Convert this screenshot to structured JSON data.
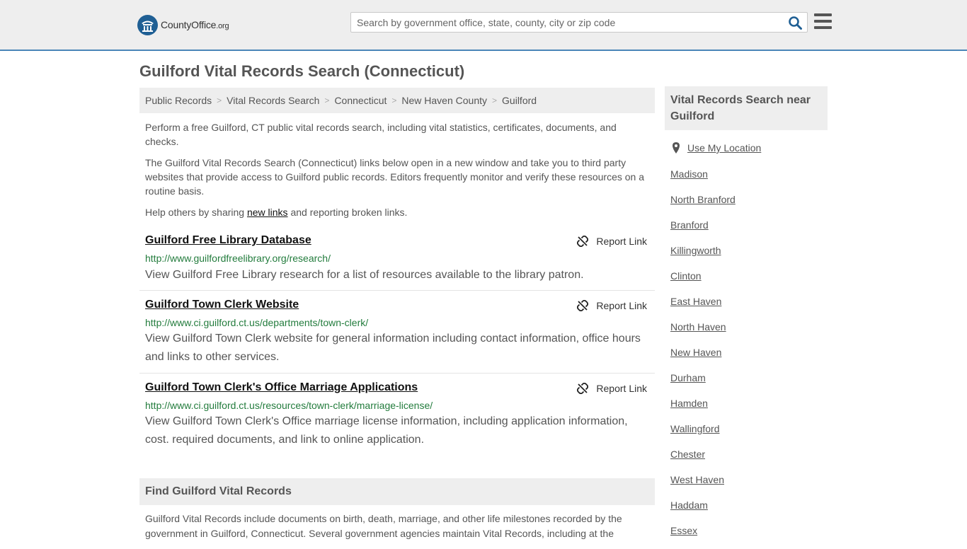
{
  "header": {
    "logo_text_main": "CountyOffice",
    "logo_text_suffix": ".org",
    "search_placeholder": "Search by government office, state, county, city or zip code"
  },
  "page": {
    "title": "Guilford Vital Records Search (Connecticut)"
  },
  "breadcrumb": [
    {
      "label": "Public Records"
    },
    {
      "label": "Vital Records Search"
    },
    {
      "label": "Connecticut"
    },
    {
      "label": "New Haven County"
    },
    {
      "label": "Guilford"
    }
  ],
  "intro": {
    "p1": "Perform a free Guilford, CT public vital records search, including vital statistics, certificates, documents, and checks.",
    "p2": "The Guilford Vital Records Search (Connecticut) links below open in a new window and take you to third party websites that provide access to Guilford public records. Editors frequently monitor and verify these resources on a routine basis.",
    "p3_before": "Help others by sharing ",
    "p3_link": "new links",
    "p3_after": " and reporting broken links."
  },
  "results": [
    {
      "title": "Guilford Free Library Database",
      "report_label": "Report Link",
      "url": "http://www.guilfordfreelibrary.org/research/",
      "description": "View Guilford Free Library research for a list of resources available to the library patron."
    },
    {
      "title": "Guilford Town Clerk Website",
      "report_label": "Report Link",
      "url": "http://www.ci.guilford.ct.us/departments/town-clerk/",
      "description": "View Guilford Town Clerk website for general information including contact information, office hours and links to other services."
    },
    {
      "title": "Guilford Town Clerk's Office Marriage Applications",
      "report_label": "Report Link",
      "url": "http://www.ci.guilford.ct.us/resources/town-clerk/marriage-license/",
      "description": "View Guilford Town Clerk's Office marriage license information, including application information, cost. required documents, and link to online application."
    }
  ],
  "find": {
    "heading": "Find Guilford Vital Records",
    "text": "Guilford Vital Records include documents on birth, death, marriage, and other life milestones recorded by the government in Guilford, Connecticut. Several government agencies maintain Vital Records, including at the"
  },
  "sidebar": {
    "heading": "Vital Records Search near Guilford",
    "use_location": "Use My Location",
    "nearby": [
      {
        "label": "Madison"
      },
      {
        "label": "North Branford"
      },
      {
        "label": "Branford"
      },
      {
        "label": "Killingworth"
      },
      {
        "label": "Clinton"
      },
      {
        "label": "East Haven"
      },
      {
        "label": "North Haven"
      },
      {
        "label": "New Haven"
      },
      {
        "label": "Durham"
      },
      {
        "label": "Hamden"
      },
      {
        "label": "Wallingford"
      },
      {
        "label": "Chester"
      },
      {
        "label": "West Haven"
      },
      {
        "label": "Haddam"
      },
      {
        "label": "Essex"
      }
    ]
  },
  "colors": {
    "header_bg": "#eeeeee",
    "header_border": "#4a86b8",
    "logo_blue": "#1f5f94",
    "url_green": "#237c3d",
    "search_icon_blue": "#1f5f94",
    "text_gray": "#555555"
  },
  "icons": {
    "logo": "county-seal-icon",
    "search": "search-icon",
    "menu": "hamburger-menu-icon",
    "report": "broken-link-icon",
    "location": "map-pin-icon"
  }
}
